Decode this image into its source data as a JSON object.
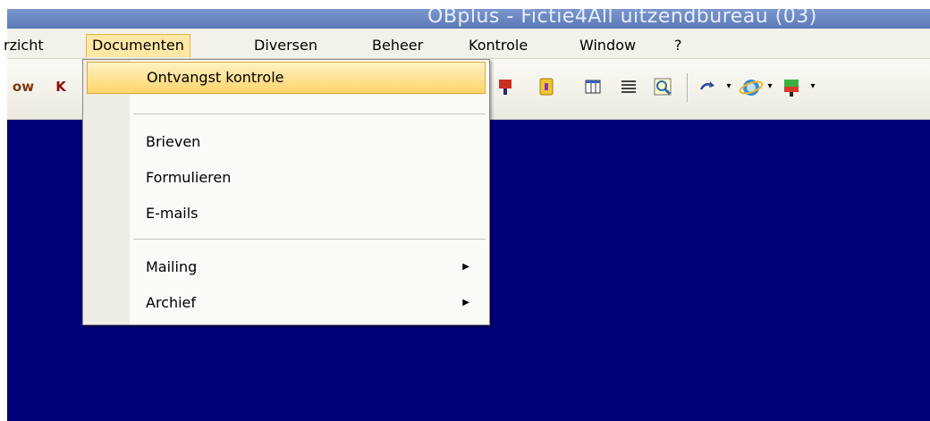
{
  "window": {
    "title": "OBplus - Fictie4All uitzendbureau (03)"
  },
  "menubar": {
    "items": [
      {
        "label": "rzicht"
      },
      {
        "label": "Documenten"
      },
      {
        "label": "Diversen"
      },
      {
        "label": "Beheer"
      },
      {
        "label": "Kontrole"
      },
      {
        "label": "Window"
      },
      {
        "label": "?"
      }
    ]
  },
  "toolbar": {
    "left_icons": [
      "ow",
      "K"
    ]
  },
  "dropdown": {
    "items": [
      {
        "label": "Ontvangst kontrole"
      },
      {
        "label": "Brieven"
      },
      {
        "label": "Formulieren"
      },
      {
        "label": "E-mails"
      },
      {
        "label": "Mailing",
        "submenu_arrow": "▶"
      },
      {
        "label": "Archief",
        "submenu_arrow": "▶"
      }
    ]
  },
  "colors": {
    "workspace": "#000078",
    "highlight": "#ffd46a",
    "menubar": "#f3f2ea"
  }
}
